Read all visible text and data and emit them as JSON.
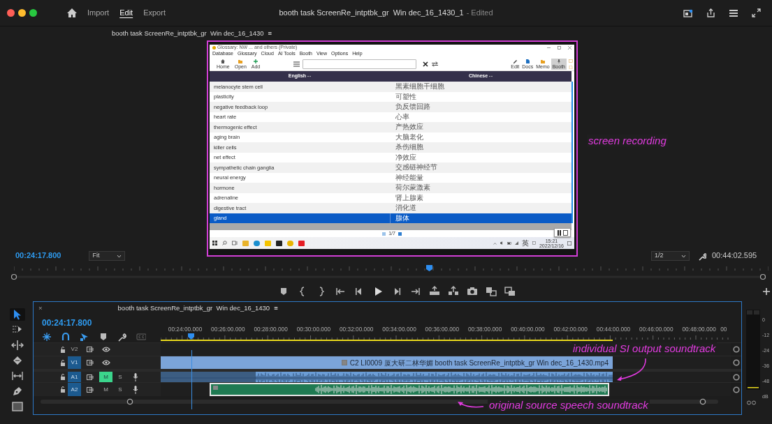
{
  "app_bar": {
    "workspaces": [
      {
        "label": "Import",
        "selected": false
      },
      {
        "label": "Edit",
        "selected": true
      },
      {
        "label": "Export",
        "selected": false
      }
    ],
    "title": "booth task ScreenRe_intptbk_gr  Win dec_16_1430_1",
    "title_suffix": "- Edited"
  },
  "program_monitor": {
    "tab_title": "booth task ScreenRe_intptbk_gr  Win dec_16_1430",
    "tab_menu": "≡",
    "recording": {
      "window_title": "Glossary: NW ... and others (Private)",
      "menu": [
        "Database",
        "Glossary",
        "Cloud",
        "AI Tools",
        "Booth",
        "View",
        "Options",
        "Help"
      ],
      "toolbar_left": [
        {
          "label": "Home"
        },
        {
          "label": "Open"
        },
        {
          "label": "Add"
        }
      ],
      "toolbar_right": [
        {
          "label": "Edit",
          "selected": false
        },
        {
          "label": "Docs",
          "selected": false
        },
        {
          "label": "Memo",
          "selected": false
        },
        {
          "label": "Booth",
          "selected": true
        }
      ],
      "columns": [
        "English",
        "Chinese"
      ],
      "rows": [
        {
          "english": "melanocyte stem cell",
          "chinese": "黑素细胞干细胞",
          "selected": false
        },
        {
          "english": "plasticity",
          "chinese": "可塑性",
          "selected": false
        },
        {
          "english": "negative feedback loop",
          "chinese": "负反馈回路",
          "selected": false
        },
        {
          "english": "heart rate",
          "chinese": "心率",
          "selected": false
        },
        {
          "english": "thermogenic effect",
          "chinese": "产热效应",
          "selected": false
        },
        {
          "english": "aging brain",
          "chinese": "大脑老化",
          "selected": false
        },
        {
          "english": "killer cells",
          "chinese": "杀伤细胞",
          "selected": false
        },
        {
          "english": "net effect",
          "chinese": "净效应",
          "selected": false
        },
        {
          "english": "sympathetic chain ganglia",
          "chinese": "交感链神经节",
          "selected": false
        },
        {
          "english": "neural energy",
          "chinese": "神经能量",
          "selected": false
        },
        {
          "english": "hormone",
          "chinese": "荷尔蒙激素",
          "selected": false
        },
        {
          "english": "adrenaline",
          "chinese": "肾上腺素",
          "selected": false
        },
        {
          "english": "digestive tract",
          "chinese": "消化道",
          "selected": false
        },
        {
          "english": "gland",
          "chinese": "腺体",
          "selected": true
        }
      ],
      "pager": "1/7",
      "ime": "英",
      "clock_time": "15:21",
      "clock_date": "2022/12/16"
    },
    "annotation": "screen recording",
    "timecode": "00:24:17.800",
    "zoom_level": "Fit",
    "resolution": "1/2",
    "duration": "00:44:02.595",
    "playhead": {
      "level": 0.55
    }
  },
  "timeline": {
    "close": "×",
    "tab_title": "booth task ScreenRe_intptbk_gr  Win dec_16_1430",
    "tab_menu": "≡",
    "timecode": "00:24:17.800",
    "ruler_labels": [
      "00:24:00.000",
      "00:26:00.000",
      "00:28:00.000",
      "00:30:00.000",
      "00:32:00.000",
      "00:34:00.000",
      "00:36:00.000",
      "00:38:00.000",
      "00:40:00.000",
      "00:42:00.000",
      "00:44:00.000",
      "00:46:00.000",
      "00:48:00.000",
      "00"
    ],
    "playhead": {
      "level": 0.053
    },
    "tracks": [
      {
        "kind": "video",
        "label": "V2",
        "targeted": false
      },
      {
        "kind": "video",
        "label": "V1",
        "targeted": true,
        "clip": {
          "name": "C2 LI0009 厦大研二林华媚 booth task ScreenRe_intptbk_gr  Win dec_16_1430.mp4",
          "color": "#7ba4d9"
        }
      },
      {
        "kind": "audio",
        "label": "A1",
        "targeted": true,
        "mute": "M",
        "muted": true,
        "solo": "S",
        "clip": {
          "color": "#6b9dd6"
        }
      },
      {
        "kind": "audio",
        "label": "A2",
        "targeted": true,
        "mute": "M",
        "muted": false,
        "solo": "S",
        "clip": {
          "color": "#1f7a52"
        }
      }
    ],
    "annotations": [
      "individual SI output soundtrack",
      "original source speech soundtrack"
    ]
  },
  "audio_meter": {
    "scale": [
      "0",
      "-12",
      "-24",
      "-36",
      "-48",
      "dB"
    ]
  }
}
